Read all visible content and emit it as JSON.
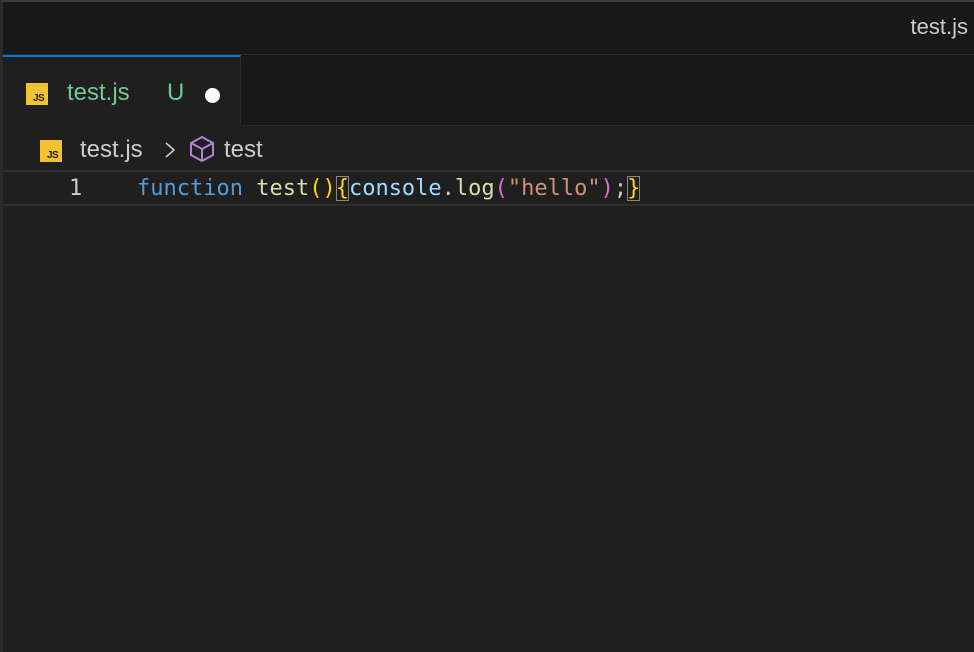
{
  "window": {
    "title": "test.js"
  },
  "tabs": [
    {
      "icon": "js-file-icon",
      "icon_text": "JS",
      "label": "test.js",
      "status": "U",
      "dirty": true,
      "active": true
    }
  ],
  "breadcrumb": {
    "file_icon_text": "JS",
    "file": "test.js",
    "separator_icon": "chevron-right-icon",
    "symbol_icon": "symbol-cube-icon",
    "symbol": "test"
  },
  "editor": {
    "lines": [
      {
        "number": "1",
        "tokens": {
          "kw": "function",
          "sp1": " ",
          "fn": "test",
          "paren_open": "(",
          "paren_close": ")",
          "brace_open": "{",
          "obj": "console",
          "dot": ".",
          "method": "log",
          "call_open": "(",
          "str": "\"hello\"",
          "call_close": ")",
          "semi": ";",
          "brace_close": "}"
        }
      }
    ]
  },
  "colors": {
    "tab_accent": "#0078d4",
    "untracked_green": "#73c991",
    "js_badge": "#f1c232",
    "keyword": "#569cd6",
    "function": "#dcdcaa",
    "bracket": "#ffd700",
    "variable": "#9cdcfe",
    "string": "#ce9178",
    "bracket_level2": "#da70d6",
    "symbol_purple": "#b180d7"
  }
}
